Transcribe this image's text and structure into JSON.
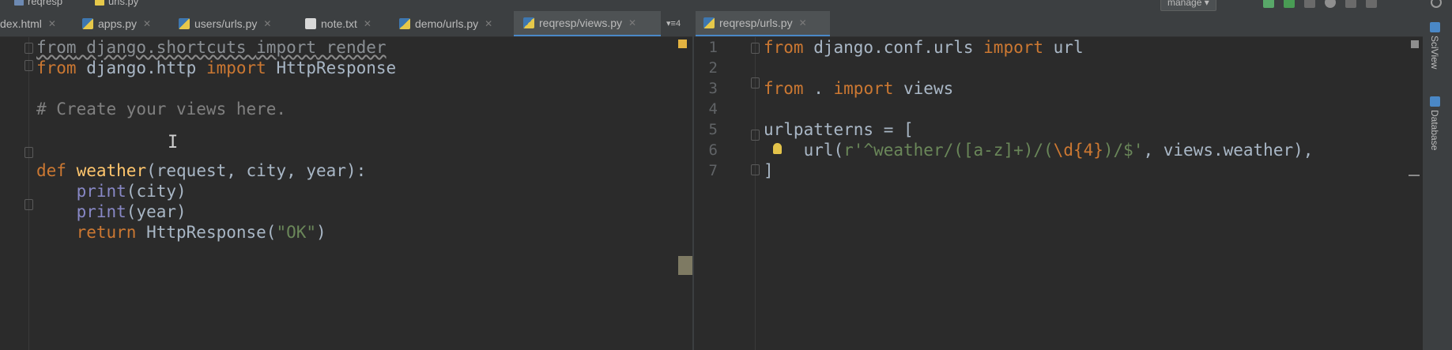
{
  "window": {
    "breadcrumb": [
      "reqresp",
      "urls.py"
    ],
    "run_config": "manage"
  },
  "tabs": [
    {
      "label": "dex.html",
      "icon": "html-file-icon",
      "active": false
    },
    {
      "label": "apps.py",
      "icon": "python-file-icon",
      "active": false
    },
    {
      "label": "users/urls.py",
      "icon": "python-file-icon",
      "active": false
    },
    {
      "label": "note.txt",
      "icon": "text-file-icon",
      "active": false
    },
    {
      "label": "demo/urls.py",
      "icon": "python-file-icon",
      "active": false
    },
    {
      "label": "reqresp/views.py",
      "icon": "python-file-icon",
      "active": true
    },
    {
      "label": "reqresp/urls.py",
      "icon": "python-file-icon",
      "active": true
    }
  ],
  "tab_overflow": "4",
  "left_editor": {
    "file": "reqresp/views.py",
    "lines": [
      "from django.shortcuts import render",
      "from django.http import HttpResponse",
      "",
      "# Create your views here.",
      "",
      "",
      "def weather(request, city, year):",
      "    print(city)",
      "    print(year)",
      "    return HttpResponse(\"OK\")"
    ]
  },
  "right_editor": {
    "file": "reqresp/urls.py",
    "line_numbers": [
      "1",
      "2",
      "3",
      "4",
      "5",
      "6",
      "7"
    ],
    "lines": [
      "from django.conf.urls import url",
      "",
      "from . import views",
      "",
      "urlpatterns = [",
      "    url(r'^weather/([a-z]+)/(\\d{4})/$', views.weather),",
      "]"
    ]
  },
  "side_tools": [
    "SciView",
    "Database"
  ],
  "colors": {
    "background": "#2b2b2b",
    "keyword": "#cc7832",
    "function": "#ffc66d",
    "comment": "#808080",
    "builtin": "#8888c6",
    "string": "#6a8759",
    "accent": "#4a88c7"
  }
}
